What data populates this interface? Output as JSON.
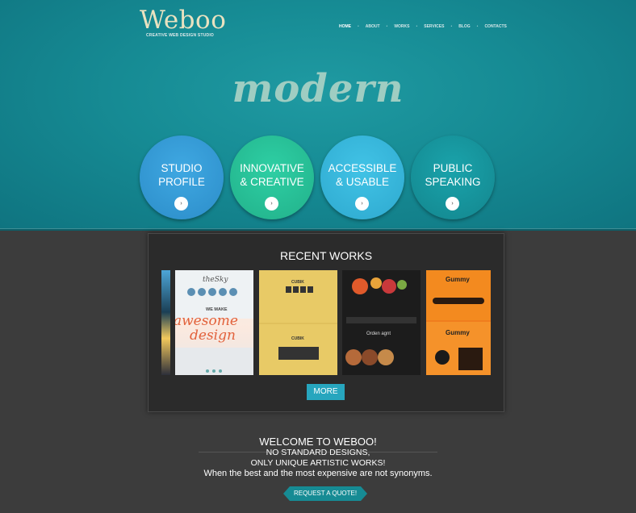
{
  "logo": {
    "title": "Weboo",
    "tagline": "CREATIVE WEB DESIGN STUDIO"
  },
  "nav": {
    "items": [
      {
        "label": "HOME",
        "active": true
      },
      {
        "label": "ABOUT",
        "active": false
      },
      {
        "label": "WORKS",
        "active": false
      },
      {
        "label": "SERVICES",
        "active": false
      },
      {
        "label": "BLOG",
        "active": false
      },
      {
        "label": "CONTACTS",
        "active": false
      }
    ]
  },
  "hero": {
    "headline": "modern"
  },
  "features": [
    {
      "line1": "STUDIO",
      "line2": "PROFILE",
      "button": "›",
      "color": "#2c8dc9"
    },
    {
      "line1": "INNOVATIVE",
      "line2": "& CREATIVE",
      "button": "›",
      "color": "#22b18a"
    },
    {
      "line1": "ACCESSIBLE",
      "line2": "& USABLE",
      "button": "›",
      "color": "#2ea9cf"
    },
    {
      "line1": "PUBLIC",
      "line2": "SPEAKING",
      "button": "›",
      "color": "#13868e"
    }
  ],
  "works": {
    "title": "RECENT WORKS",
    "more_label": "MORE",
    "thumbs": [
      {
        "texts": []
      },
      {
        "texts": [
          "theSky",
          "WE MAKE",
          "awesome",
          "design"
        ]
      },
      {
        "texts": [
          "CUBIK",
          "CUBIK"
        ]
      },
      {
        "texts": [
          "Orden agnt"
        ]
      },
      {
        "texts": [
          "Gummy",
          "Gummy"
        ]
      }
    ]
  },
  "welcome": {
    "title": "WELCOME TO WEBOO!",
    "line1": "NO STANDARD DESIGNS,",
    "line2": "ONLY UNIQUE ARTISTIC WORKS!",
    "line3": "When the best and the most expensive are not synonyms.",
    "quote_label": "REQUEST A QUOTE!"
  },
  "colors": {
    "accent": "#168b94",
    "more_button": "#27a6be"
  }
}
